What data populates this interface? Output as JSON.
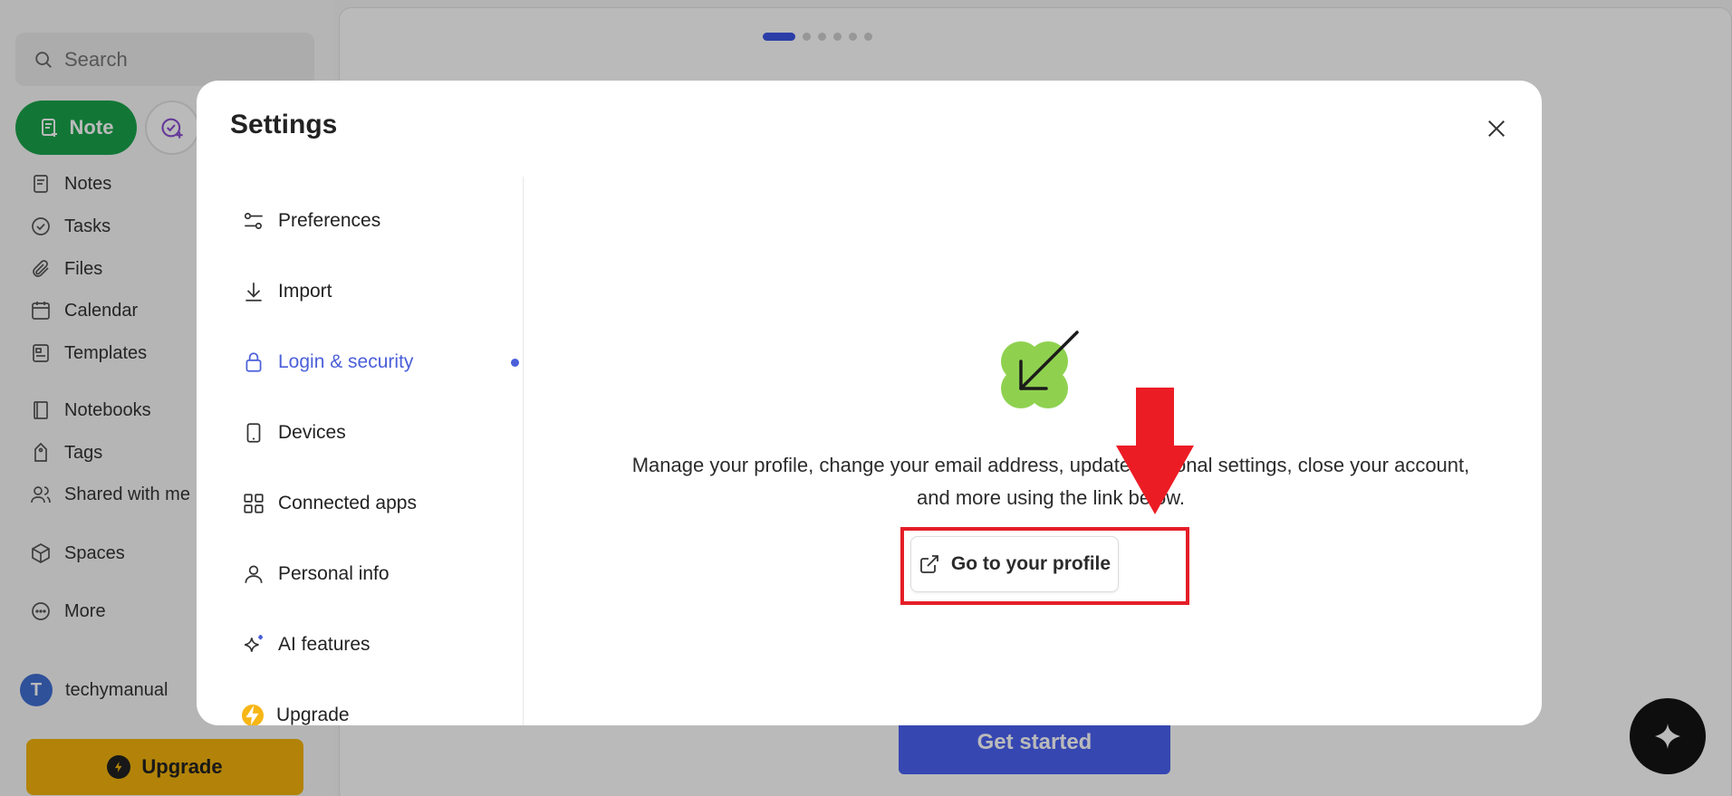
{
  "sidebar": {
    "search_placeholder": "Search",
    "note_button": "Note",
    "items": [
      {
        "label": "Notes",
        "icon": "notes-icon"
      },
      {
        "label": "Tasks",
        "icon": "check-circle-icon"
      },
      {
        "label": "Files",
        "icon": "paperclip-icon"
      },
      {
        "label": "Calendar",
        "icon": "calendar-icon"
      },
      {
        "label": "Templates",
        "icon": "template-icon"
      },
      {
        "label": "Notebooks",
        "icon": "notebook-icon"
      },
      {
        "label": "Tags",
        "icon": "tag-icon"
      },
      {
        "label": "Shared with me",
        "icon": "users-icon"
      },
      {
        "label": "Spaces",
        "icon": "cube-icon"
      },
      {
        "label": "More",
        "icon": "more-icon"
      }
    ],
    "account": {
      "initial": "T",
      "name": "techymanual"
    },
    "upgrade_button": "Upgrade"
  },
  "main": {
    "get_started_button": "Get started"
  },
  "modal": {
    "title": "Settings",
    "menu": [
      {
        "label": "Preferences",
        "icon": "sliders-icon"
      },
      {
        "label": "Import",
        "icon": "download-icon"
      },
      {
        "label": "Login & security",
        "icon": "lock-icon"
      },
      {
        "label": "Devices",
        "icon": "phone-icon"
      },
      {
        "label": "Connected apps",
        "icon": "grid-icon"
      },
      {
        "label": "Personal info",
        "icon": "person-icon"
      },
      {
        "label": "AI features",
        "icon": "sparkle-icon"
      },
      {
        "label": "Upgrade",
        "icon": "bolt-icon"
      }
    ],
    "active_item": "Login & security",
    "content": {
      "description": "Manage your profile, change your email address, update personal settings, close your account, and more using the link below.",
      "profile_button": "Go to your profile"
    }
  },
  "colors": {
    "accent": "#4a5fd9",
    "note_green": "#1aa34a",
    "upgrade_yellow": "#f5b40c",
    "annotation_red": "#e41e27"
  }
}
